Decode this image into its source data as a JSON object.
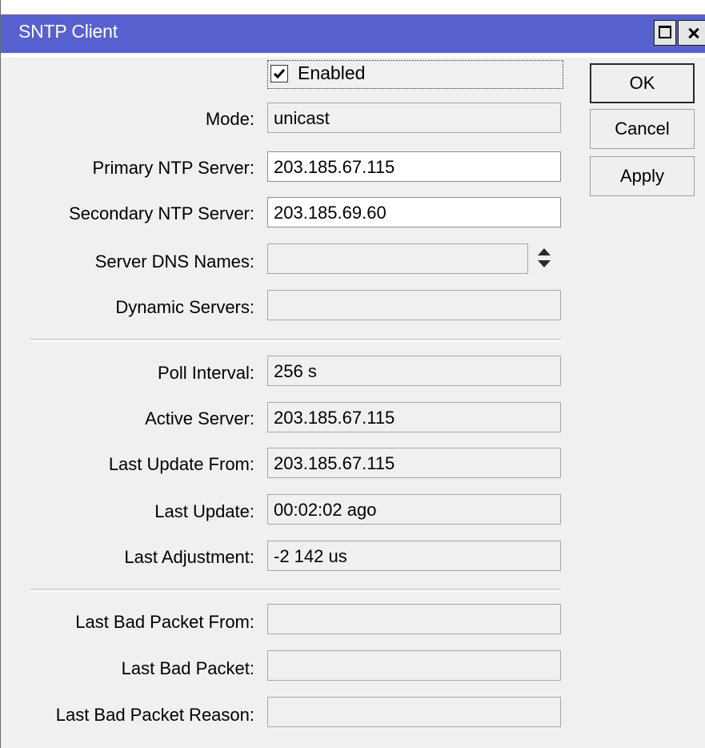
{
  "window": {
    "title": "SNTP Client"
  },
  "enabled": {
    "label": "Enabled",
    "checked": true
  },
  "buttons": {
    "ok": "OK",
    "cancel": "Cancel",
    "apply": "Apply"
  },
  "fields": {
    "mode": {
      "label": "Mode:",
      "value": "unicast"
    },
    "primary_ntp_server": {
      "label": "Primary NTP Server:",
      "value": "203.185.67.115"
    },
    "secondary_ntp_server": {
      "label": "Secondary NTP Server:",
      "value": "203.185.69.60"
    },
    "server_dns_names": {
      "label": "Server DNS Names:",
      "value": ""
    },
    "dynamic_servers": {
      "label": "Dynamic Servers:",
      "value": ""
    },
    "poll_interval": {
      "label": "Poll Interval:",
      "value": "256 s"
    },
    "active_server": {
      "label": "Active Server:",
      "value": "203.185.67.115"
    },
    "last_update_from": {
      "label": "Last Update From:",
      "value": "203.185.67.115"
    },
    "last_update": {
      "label": "Last Update:",
      "value": "00:02:02 ago"
    },
    "last_adjustment": {
      "label": "Last Adjustment:",
      "value": "-2 142 us"
    },
    "last_bad_packet_from": {
      "label": "Last Bad Packet From:",
      "value": ""
    },
    "last_bad_packet": {
      "label": "Last Bad Packet:",
      "value": ""
    },
    "last_bad_packet_reason": {
      "label": "Last Bad Packet Reason:",
      "value": ""
    }
  },
  "colors": {
    "titlebar": "#5661cf",
    "window_background": "#f0f0f0",
    "editable_field": "#ffffff"
  }
}
